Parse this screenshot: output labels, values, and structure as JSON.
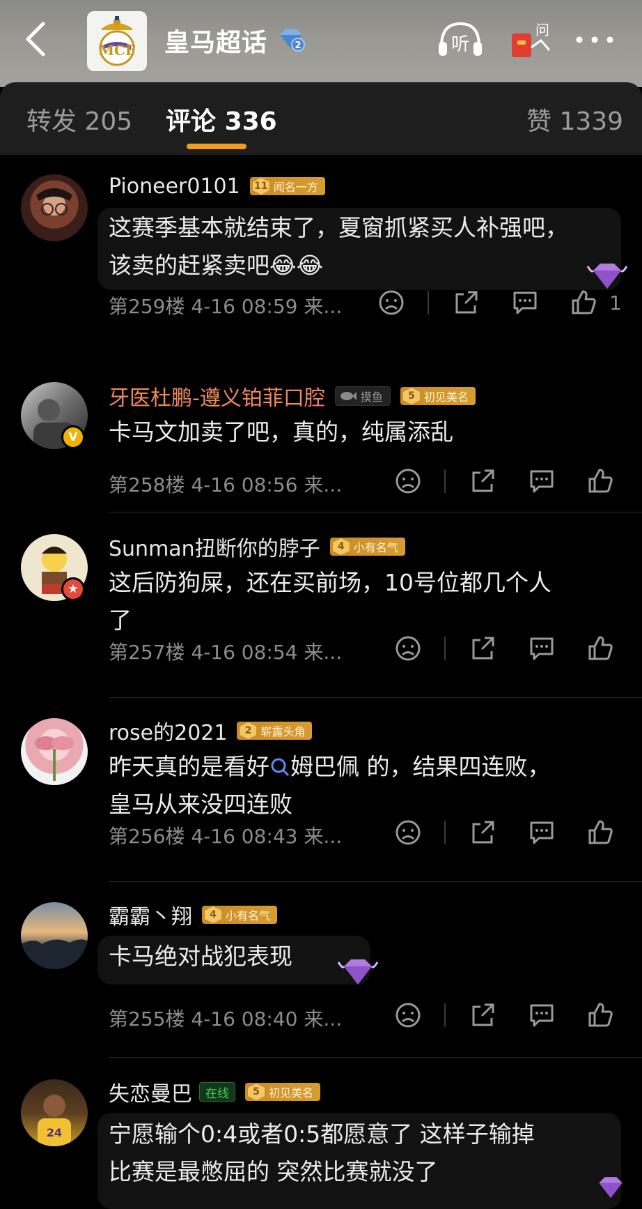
{
  "header": {
    "title": "皇马超话",
    "listen_label": "听",
    "ask_label": "问"
  },
  "tabs": [
    {
      "label": "转发",
      "count": "205"
    },
    {
      "label": "评论",
      "count": "336"
    },
    {
      "label": "赞",
      "count": "1339"
    }
  ],
  "comments": [
    {
      "username": "Pioneer0101",
      "medal_level": "11",
      "medal_text": "闻名一方",
      "text_lines": [
        "这赛季基本就结束了，夏窗抓紧买人补强吧，",
        "该卖的赶紧卖吧"
      ],
      "emoji": [
        "😂",
        "😂"
      ],
      "floor": "第259楼",
      "time": "4-16 08:59",
      "source": "来...",
      "likes": "1"
    },
    {
      "username": "牙医杜鹏-遵义铂菲口腔",
      "fish_tag": "摸鱼",
      "medal_level": "5",
      "medal_text": "初见美名",
      "text_lines": [
        "卡马文加卖了吧，真的，纯属添乱"
      ],
      "floor": "第258楼",
      "time": "4-16 08:56",
      "source": "来...",
      "verified_badge": "V"
    },
    {
      "username": "Sunman扭断你的脖子",
      "medal_level": "4",
      "medal_text": "小有名气",
      "text_lines": [
        "这后防狗屎，还在买前场，10号位都几个人",
        "了"
      ],
      "floor": "第257楼",
      "time": "4-16 08:54",
      "source": "来..."
    },
    {
      "username": "rose的2021",
      "medal_level": "2",
      "medal_text": "崭露头角",
      "text_before_link": "昨天真的是看好",
      "link_text": "姆巴佩",
      "text_after_link": " 的，结果四连败，",
      "text_line2": "皇马从来没四连败",
      "floor": "第256楼",
      "time": "4-16 08:43",
      "source": "来..."
    },
    {
      "username": "霸霸丶翔",
      "medal_level": "4",
      "medal_text": "小有名气",
      "text_lines": [
        "卡马绝对战犯表现"
      ],
      "floor": "第255楼",
      "time": "4-16 08:40",
      "source": "来..."
    },
    {
      "username": "失恋曼巴",
      "online_tag": "在线",
      "medal_level": "5",
      "medal_text": "初见美名",
      "text_lines": [
        "宁愿输个0:4或者0:5都愿意了 这样子输掉",
        "比赛是最憋屈的 突然比赛就没了"
      ]
    }
  ],
  "colors": {
    "accent": "#f59a1b",
    "background": "#000000",
    "panel": "#1e1e1e",
    "medal": "#d4972d",
    "username_highlight": "#f08a5a",
    "online": "#46c95a"
  },
  "icons": [
    "back-arrow-icon",
    "club-crest-icon",
    "gem-badge-icon",
    "listen-headphones-icon",
    "red-envelope-icon",
    "more-icon",
    "dislike-icon",
    "share-icon",
    "comment-icon",
    "like-icon",
    "search-icon",
    "purple-gem-icon"
  ]
}
